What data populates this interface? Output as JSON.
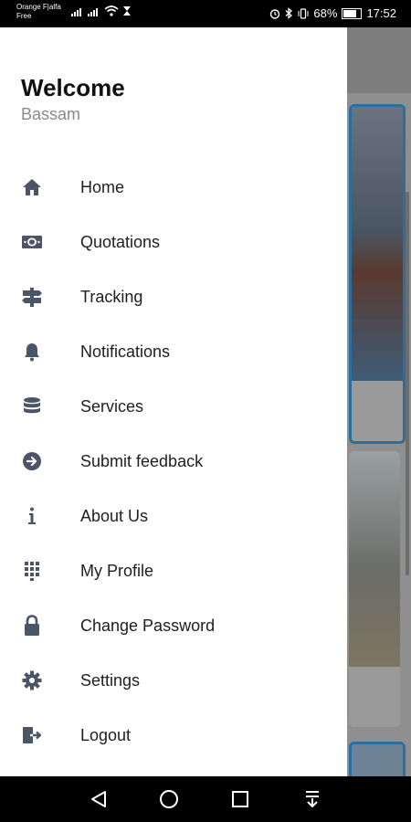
{
  "status_bar": {
    "carrier_line1": "Orange F|alfa",
    "carrier_line2": "Free",
    "battery": "68%",
    "time": "17:52"
  },
  "drawer": {
    "title": "Welcome",
    "user_name": "Bassam",
    "menu": [
      {
        "label": "Home",
        "icon": "home-icon"
      },
      {
        "label": "Quotations",
        "icon": "money-icon"
      },
      {
        "label": "Tracking",
        "icon": "signpost-icon"
      },
      {
        "label": "Notifications",
        "icon": "bell-icon"
      },
      {
        "label": "Services",
        "icon": "database-icon"
      },
      {
        "label": "Submit feedback",
        "icon": "arrow-circle-right-icon"
      },
      {
        "label": "About Us",
        "icon": "info-icon"
      },
      {
        "label": "My Profile",
        "icon": "dialpad-icon"
      },
      {
        "label": "Change Password",
        "icon": "lock-icon"
      },
      {
        "label": "Settings",
        "icon": "gear-icon"
      },
      {
        "label": "Logout",
        "icon": "logout-icon"
      }
    ]
  },
  "colors": {
    "icon": "#4a5568",
    "drawer_bg": "#ffffff",
    "scrim": "#8f8f8f",
    "card_border": "#2b6fa0"
  },
  "nav_bar": {
    "buttons": [
      "back-icon",
      "home-circle-icon",
      "recents-icon",
      "notification-pull-icon"
    ]
  }
}
